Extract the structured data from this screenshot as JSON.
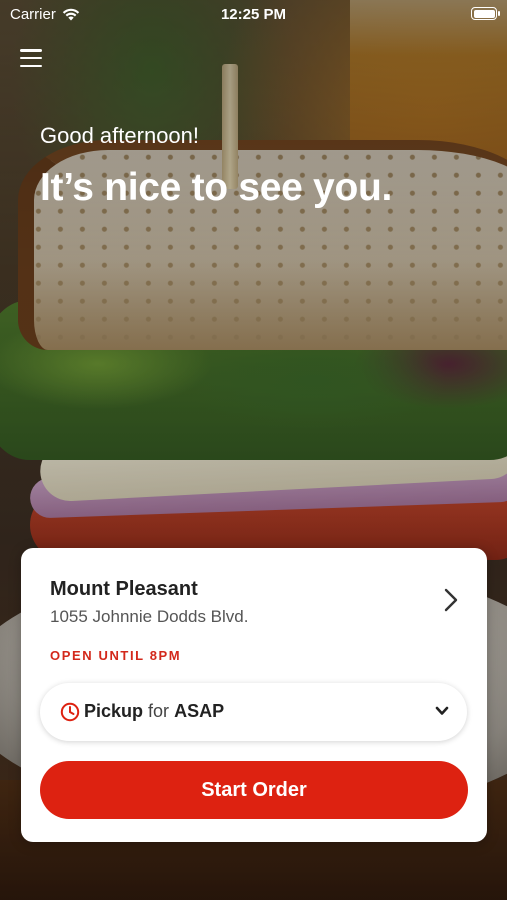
{
  "status_bar": {
    "carrier": "Carrier",
    "time": "12:25 PM"
  },
  "header": {
    "greeting": "Good afternoon!",
    "headline": "It’s nice to see you."
  },
  "location": {
    "name": "Mount Pleasant",
    "address": "1055 Johnnie Dodds Blvd.",
    "hours": "OPEN UNTIL 8PM"
  },
  "order_mode": {
    "method": "Pickup",
    "connector": "for",
    "timing": "ASAP"
  },
  "actions": {
    "start_order": "Start Order"
  },
  "colors": {
    "accent": "#dd2211",
    "hours_text": "#d3281b"
  },
  "icons": [
    "wifi-icon",
    "battery-icon",
    "hamburger-menu-icon",
    "chevron-right-icon",
    "clock-icon",
    "chevron-down-icon"
  ]
}
